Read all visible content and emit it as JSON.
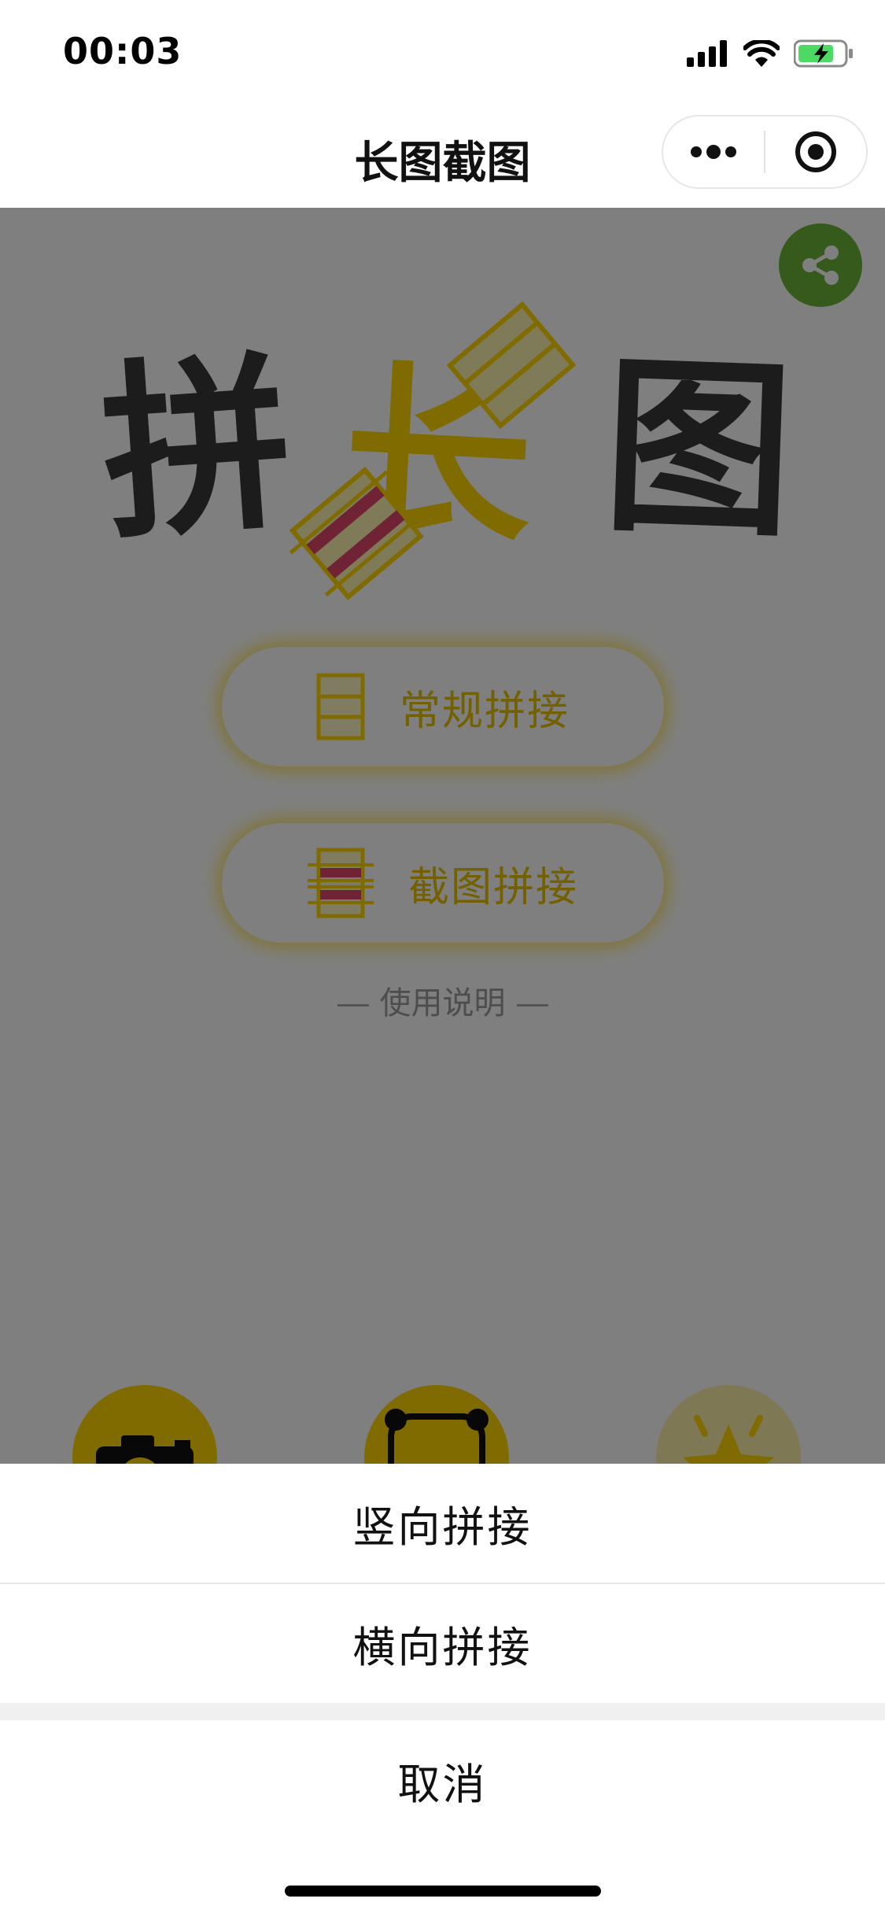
{
  "status_bar": {
    "time": "00:03",
    "icons": [
      "signal-icon",
      "wifi-icon",
      "battery-charging-icon"
    ]
  },
  "nav": {
    "title": "长图截图",
    "capsule": [
      "more-icon",
      "close-target-icon"
    ]
  },
  "colors": {
    "accent_yellow": "#ffd600",
    "share_green": "#6bb536",
    "overlay": "rgba(0,0,0,0.5)"
  },
  "logo": {
    "chars": [
      "拼",
      "长",
      "图"
    ]
  },
  "main": {
    "buttons": [
      {
        "label": "常规拼接",
        "icon": "stacked-rows-icon"
      },
      {
        "label": "截图拼接",
        "icon": "screenshot-strips-icon"
      }
    ],
    "instructions": "使用说明"
  },
  "bottom_icons": [
    "camera-icon",
    "bear-icon",
    "star-icon"
  ],
  "action_sheet": {
    "items": [
      "竖向拼接",
      "横向拼接"
    ],
    "cancel": "取消"
  }
}
